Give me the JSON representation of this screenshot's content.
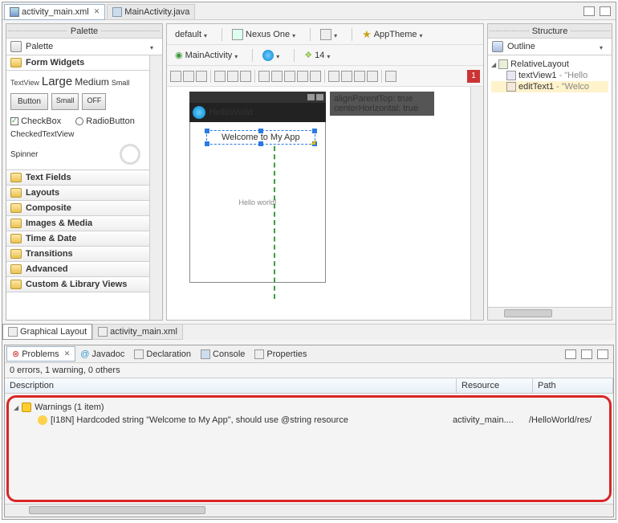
{
  "tabs": {
    "active": "activity_main.xml",
    "other": "MainActivity.java"
  },
  "palette": {
    "title": "Palette",
    "header": "Palette",
    "formWidgets": "Form Widgets",
    "textViewLabel": "TextView",
    "large": "Large",
    "medium": "Medium",
    "small": "Small",
    "button": "Button",
    "btnSmall": "Small",
    "btnOff": "OFF",
    "checkbox": "CheckBox",
    "radio": "RadioButton",
    "checkedTextView": "CheckedTextView",
    "spinner": "Spinner",
    "folders": [
      "Text Fields",
      "Layouts",
      "Composite",
      "Images & Media",
      "Time & Date",
      "Transitions",
      "Advanced",
      "Custom & Library Views"
    ]
  },
  "toolbar": {
    "config": "default",
    "device": "Nexus One",
    "theme": "AppTheme",
    "activity": "MainActivity",
    "api": "14"
  },
  "preview": {
    "appTitle": "HelloWorld",
    "editText": "Welcome to My App",
    "centerText": "Hello world!",
    "tooltip1": "alignParentTop: true",
    "tooltip2": "centerHorizontal: true",
    "errorCount": "1"
  },
  "structure": {
    "title": "Structure",
    "outline": "Outline",
    "root": "RelativeLayout",
    "child1": "textView1",
    "child1d": "- \"Hello",
    "child2": "editText1",
    "child2d": "- \"Welco"
  },
  "bottomTabs": {
    "graphical": "Graphical Layout",
    "xml": "activity_main.xml"
  },
  "problems": {
    "tabs": [
      "Problems",
      "Javadoc",
      "Declaration",
      "Console",
      "Properties"
    ],
    "summary": "0 errors, 1 warning, 0 others",
    "cols": {
      "desc": "Description",
      "res": "Resource",
      "path": "Path"
    },
    "warnHeader": "Warnings (1 item)",
    "warnText": "[I18N] Hardcoded string \"Welcome to My App\", should use @string resource",
    "warnRes": "activity_main....",
    "warnPath": "/HelloWorld/res/"
  }
}
